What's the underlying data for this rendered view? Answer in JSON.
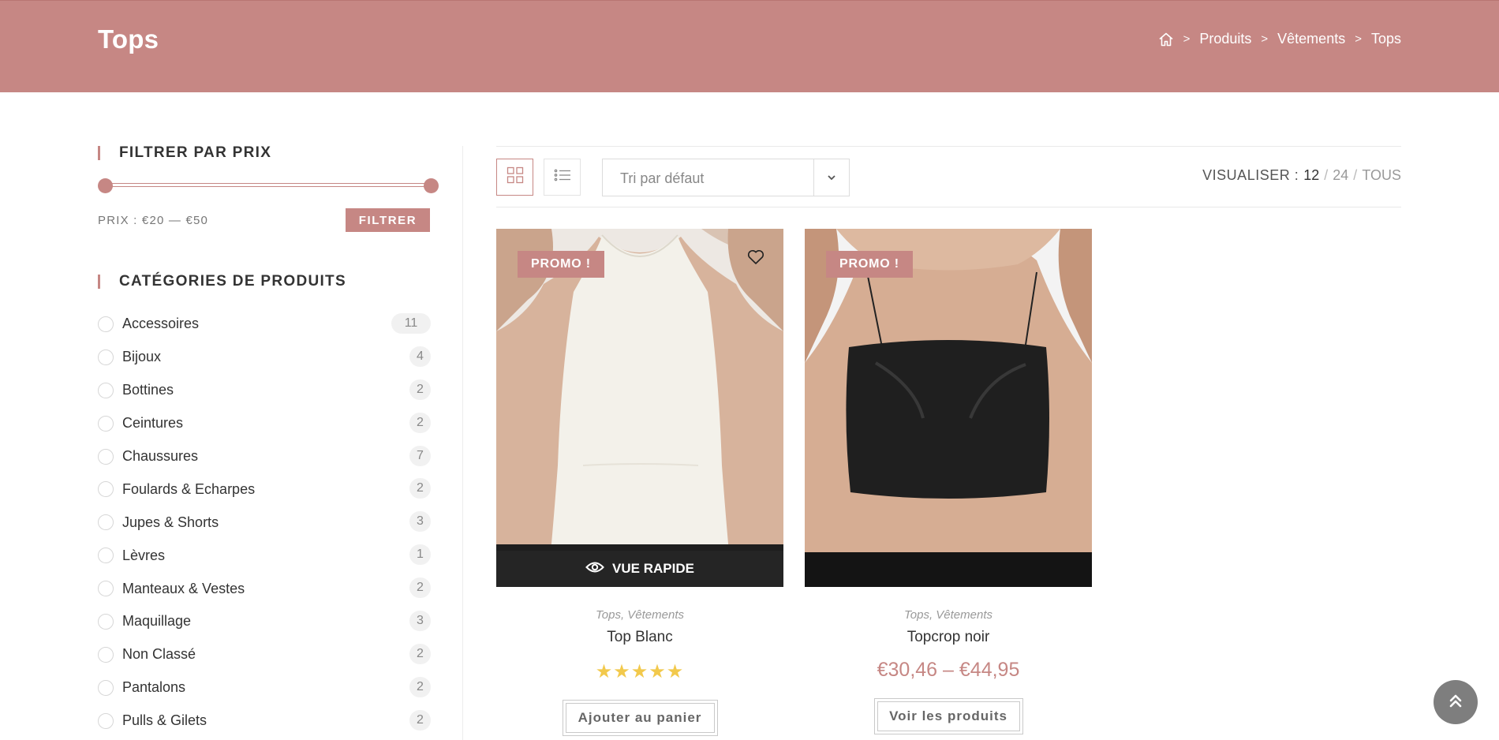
{
  "header": {
    "title": "Tops",
    "breadcrumb": [
      "Produits",
      "Vêtements",
      "Tops"
    ],
    "breadcrumb_sep": ">",
    "home_icon": "home-icon"
  },
  "sidebar": {
    "price_filter": {
      "title": "FILTRER PAR PRIX",
      "label": "PRIX : €20 — €50",
      "button": "FILTRER"
    },
    "categories": {
      "title": "CATÉGORIES DE PRODUITS",
      "items": [
        {
          "name": "Accessoires",
          "count": "11"
        },
        {
          "name": "Bijoux",
          "count": "4"
        },
        {
          "name": "Bottines",
          "count": "2"
        },
        {
          "name": "Ceintures",
          "count": "2"
        },
        {
          "name": "Chaussures",
          "count": "7"
        },
        {
          "name": "Foulards & Echarpes",
          "count": "2"
        },
        {
          "name": "Jupes & Shorts",
          "count": "3"
        },
        {
          "name": "Lèvres",
          "count": "1"
        },
        {
          "name": "Manteaux & Vestes",
          "count": "2"
        },
        {
          "name": "Maquillage",
          "count": "3"
        },
        {
          "name": "Non Classé",
          "count": "2"
        },
        {
          "name": "Pantalons",
          "count": "2"
        },
        {
          "name": "Pulls & Gilets",
          "count": "2"
        }
      ]
    }
  },
  "toolbar": {
    "grid_view_icon": "grid-view-icon",
    "list_view_icon": "list-view-icon",
    "sort_value": "Tri par défaut",
    "per_page_label": "VISUALISER :",
    "per_page_current": "12",
    "per_page_options": [
      "24",
      "TOUS"
    ],
    "per_page_sep": "/"
  },
  "products": [
    {
      "badge": "PROMO !",
      "categories": "Tops, Vêtements",
      "title": "Top Blanc",
      "rating": "★★★★★",
      "quick_view": "VUE RAPIDE",
      "button": "Ajouter au panier"
    },
    {
      "badge": "PROMO !",
      "categories": "Tops, Vêtements",
      "title": "Topcrop noir",
      "price": "€30,46 – €44,95",
      "button": "Voir les produits"
    }
  ],
  "colors": {
    "accent": "#c68784",
    "star": "#f2c94c"
  }
}
